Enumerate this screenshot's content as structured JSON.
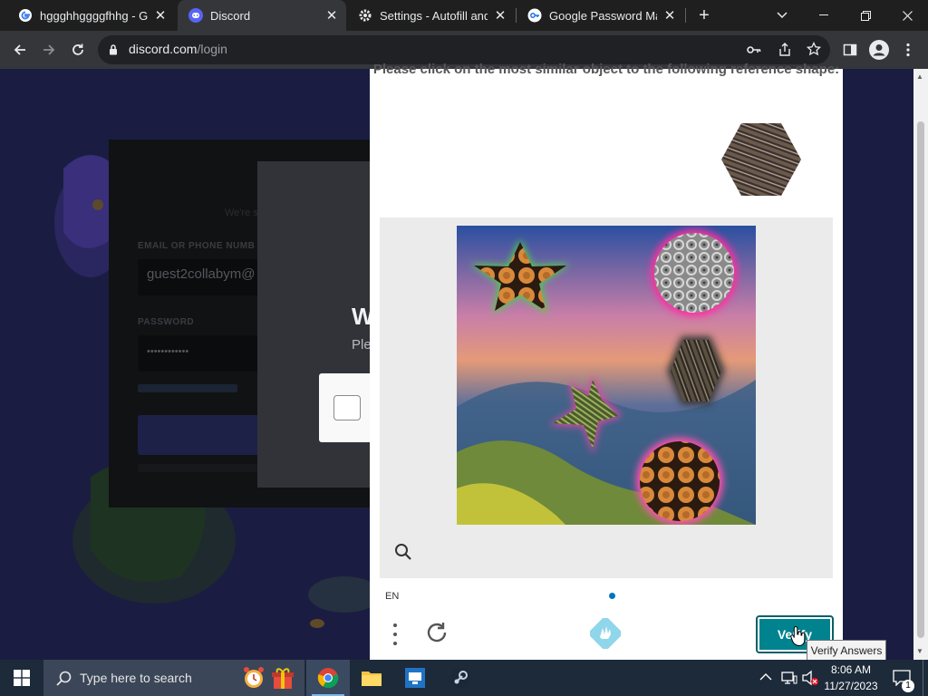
{
  "browser": {
    "tabs": [
      {
        "label": "hggghhggggfhhg - Go",
        "icon": "google-icon",
        "active": false
      },
      {
        "label": "Discord",
        "icon": "discord-icon",
        "active": true
      },
      {
        "label": "Settings - Autofill and",
        "icon": "gear-icon",
        "active": false
      },
      {
        "label": "Google Password Man",
        "icon": "key-icon",
        "active": false
      }
    ],
    "url_host": "discord.com",
    "url_path": "/login"
  },
  "discord": {
    "heading_partial": "W",
    "subtext_partial": "Ple",
    "email_label": "EMAIL OR PHONE NUMB",
    "email_value": "guest2collabym@",
    "password_label": "PASSWORD",
    "password_value": "••••••••••••"
  },
  "captcha": {
    "prompt": "Please click on the most similar object to the following reference shape:",
    "language": "EN",
    "verify_label": "Verify",
    "tooltip": "Verify Answers",
    "colors": {
      "verify_bg": "#00838f",
      "pager_dot": "#0074bf"
    }
  },
  "taskbar": {
    "search_placeholder": "Type here to search",
    "time": "8:06 AM",
    "date": "11/27/2023",
    "notification_count": "1"
  }
}
